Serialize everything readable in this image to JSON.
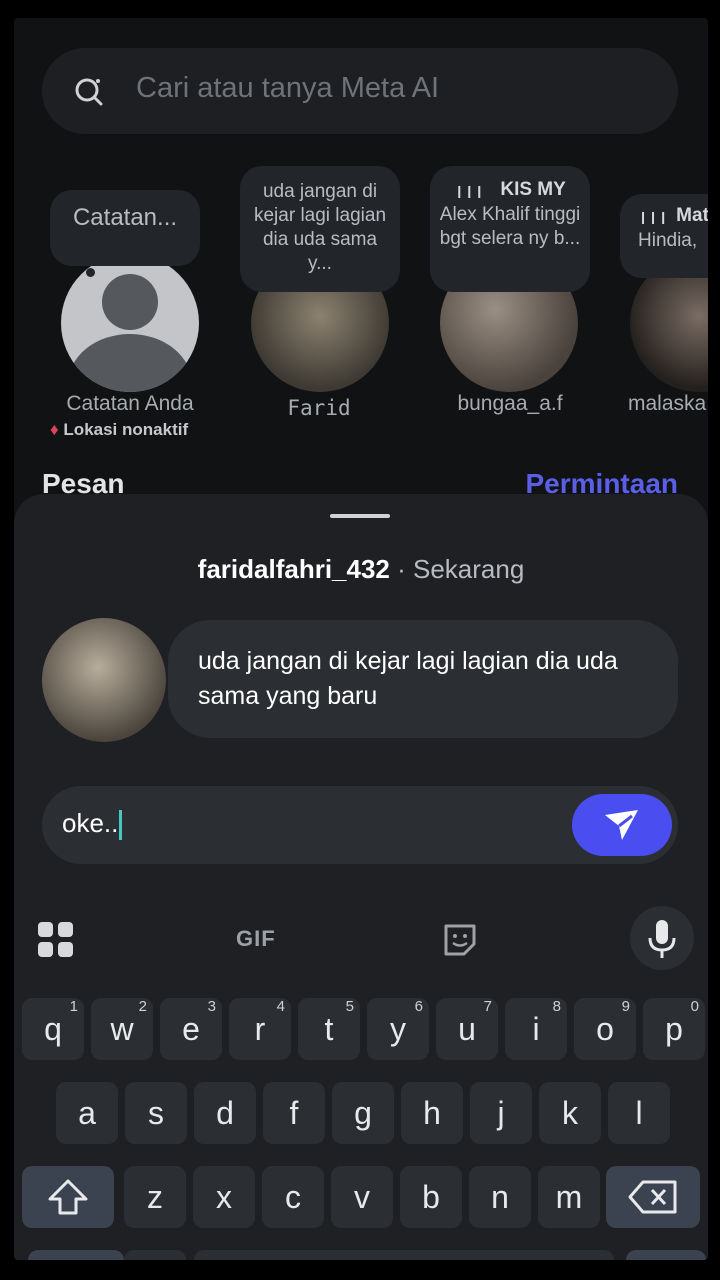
{
  "search": {
    "placeholder": "Cari atau tanya Meta AI"
  },
  "notes": [
    {
      "bubble": "Catatan...",
      "name": "Catatan Anda",
      "sub": "Lokasi nonaktif"
    },
    {
      "bubble": "uda jangan di kejar lagi lagian dia uda sama y...",
      "name": "Farid"
    },
    {
      "bubble_title": "KIS MY",
      "bubble": "Alex Khalif tinggi bgt selera ny b...",
      "name": "bungaa_a.f"
    },
    {
      "bubble_title": "Mat",
      "bubble": "Hindia,",
      "name": "malaska"
    }
  ],
  "sections": {
    "messages": "Pesan",
    "requests": "Permintaan"
  },
  "sheet": {
    "sender": "faridalfahri_432",
    "separator": " · ",
    "time": "Sekarang",
    "message": "uda jangan di kejar lagi lagian dia uda sama yang baru",
    "reply_value": "oke.."
  },
  "keyboard": {
    "gif": "GIF",
    "row1": [
      "q",
      "w",
      "e",
      "r",
      "t",
      "y",
      "u",
      "i",
      "o",
      "p"
    ],
    "row1_hints": [
      "1",
      "2",
      "3",
      "4",
      "5",
      "6",
      "7",
      "8",
      "9",
      "0"
    ],
    "row2": [
      "a",
      "s",
      "d",
      "f",
      "g",
      "h",
      "j",
      "k",
      "l"
    ],
    "row3": [
      "z",
      "x",
      "c",
      "v",
      "b",
      "n",
      "m"
    ]
  },
  "colors": {
    "accent": "#4a4ef0",
    "link": "#5b5fe8",
    "background": "#101214"
  }
}
